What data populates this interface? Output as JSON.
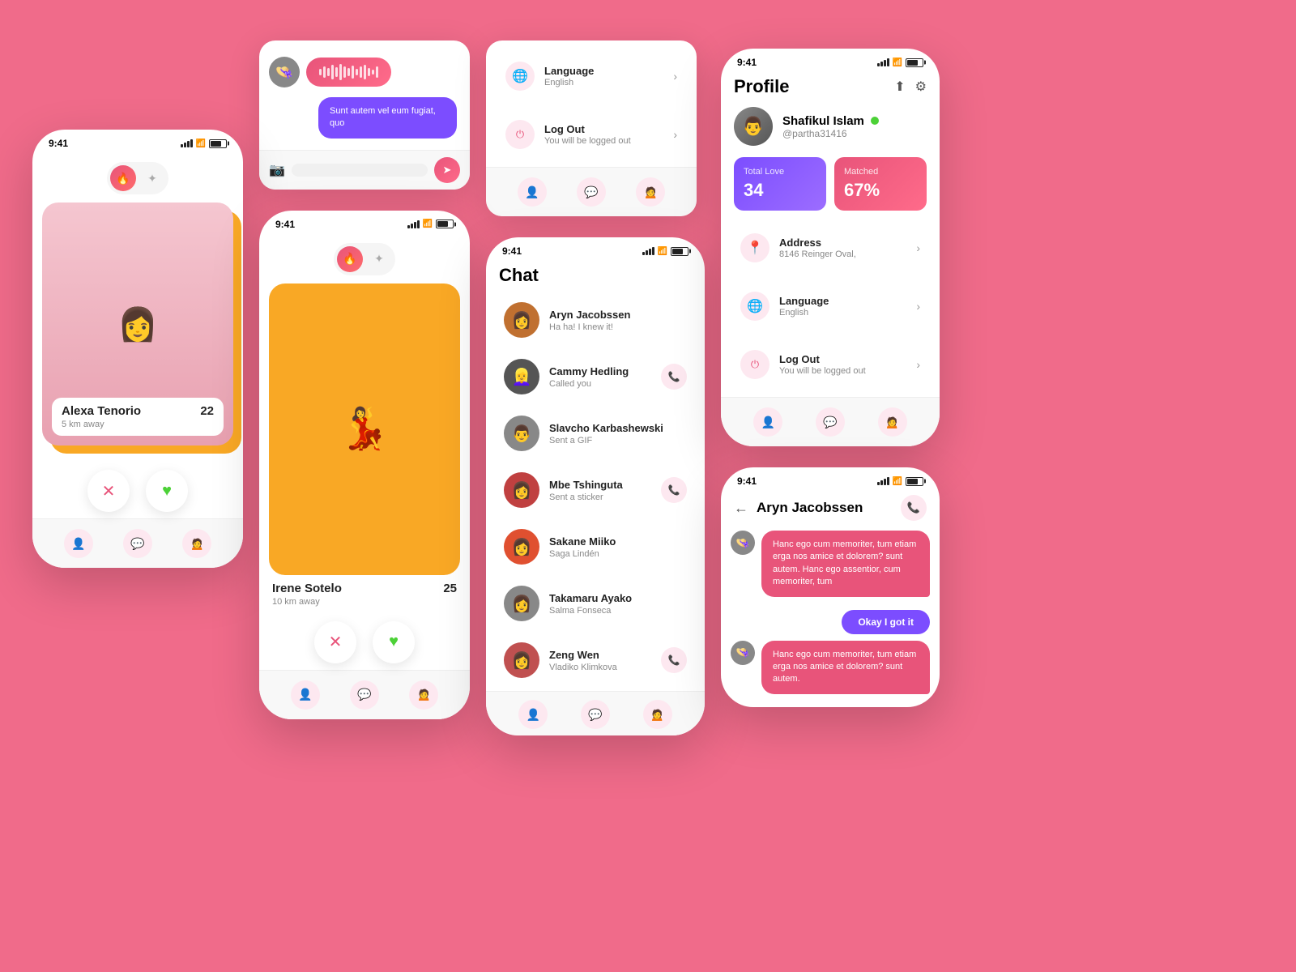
{
  "bg_color": "#f06b8a",
  "phones": {
    "swipe1": {
      "time": "9:41",
      "person": {
        "name": "Alexa Tenorio",
        "age": "22",
        "distance": "5 km away"
      }
    },
    "swipe2": {
      "time": "9:41",
      "person": {
        "name": "Irene Sotelo",
        "age": "25",
        "distance": "10 km away"
      }
    },
    "chat_list": {
      "time": "9:41",
      "title": "Chat",
      "items": [
        {
          "name": "Aryn Jacobssen",
          "msg": "Ha ha! I knew it!",
          "color": "#c07030",
          "has_call": false
        },
        {
          "name": "Cammy Hedling",
          "msg": "Called you",
          "color": "#555",
          "has_call": true
        },
        {
          "name": "Slavcho Karbashewski",
          "msg": "Sent a GIF",
          "color": "#888",
          "has_call": false
        },
        {
          "name": "Mbe Tshinguta",
          "msg": "Sent a sticker",
          "color": "#c04040",
          "has_call": true
        },
        {
          "name": "Sakane Miiko",
          "msg": "Saga Lindén",
          "color": "#e05030",
          "has_call": false
        },
        {
          "name": "Takamaru Ayako",
          "msg": "Salma Fonseca",
          "color": "#888",
          "has_call": false
        },
        {
          "name": "Zeng Wen",
          "msg": "Vladiko Klimkova",
          "color": "#c05050",
          "has_call": true
        }
      ]
    },
    "settings1": {
      "items": [
        {
          "icon": "🌐",
          "main": "Language",
          "sub": "English"
        },
        {
          "icon": "⏻",
          "main": "Log Out",
          "sub": "You will be logged out"
        }
      ]
    },
    "settings2": {
      "time": "9:41",
      "items": [
        {
          "icon": "📍",
          "main": "Address",
          "sub": "8146 Reinger Oval,"
        },
        {
          "icon": "🌐",
          "main": "Language",
          "sub": "English"
        },
        {
          "icon": "⏻",
          "main": "Log Out",
          "sub": "You will be logged out"
        }
      ]
    },
    "profile": {
      "time": "9:41",
      "title": "Profile",
      "username": "Shafikul Islam",
      "handle": "@partha31416",
      "stats": {
        "total_love_label": "Total Love",
        "total_love_value": "34",
        "matched_label": "Matched",
        "matched_value": "67%"
      }
    },
    "chat_detail": {
      "time": "9:41",
      "contact": "Aryn Jacobssen",
      "messages": [
        {
          "text": "Hanc ego cum memoriter, tum etiam erga nos amice et dolorem? sunt autem. Hanc ego assentior, cum memoriter, tum",
          "type": "received"
        },
        {
          "text": "Okay I got it",
          "type": "sent_btn"
        },
        {
          "text": "Hanc ego cum memoriter, tum etiam erga nos amice et dolorem? sunt autem.",
          "type": "received"
        }
      ]
    },
    "partial_chat": {
      "voice_msg": true,
      "text_msg": "Sunt autem vel eum fugiat, quo"
    }
  }
}
